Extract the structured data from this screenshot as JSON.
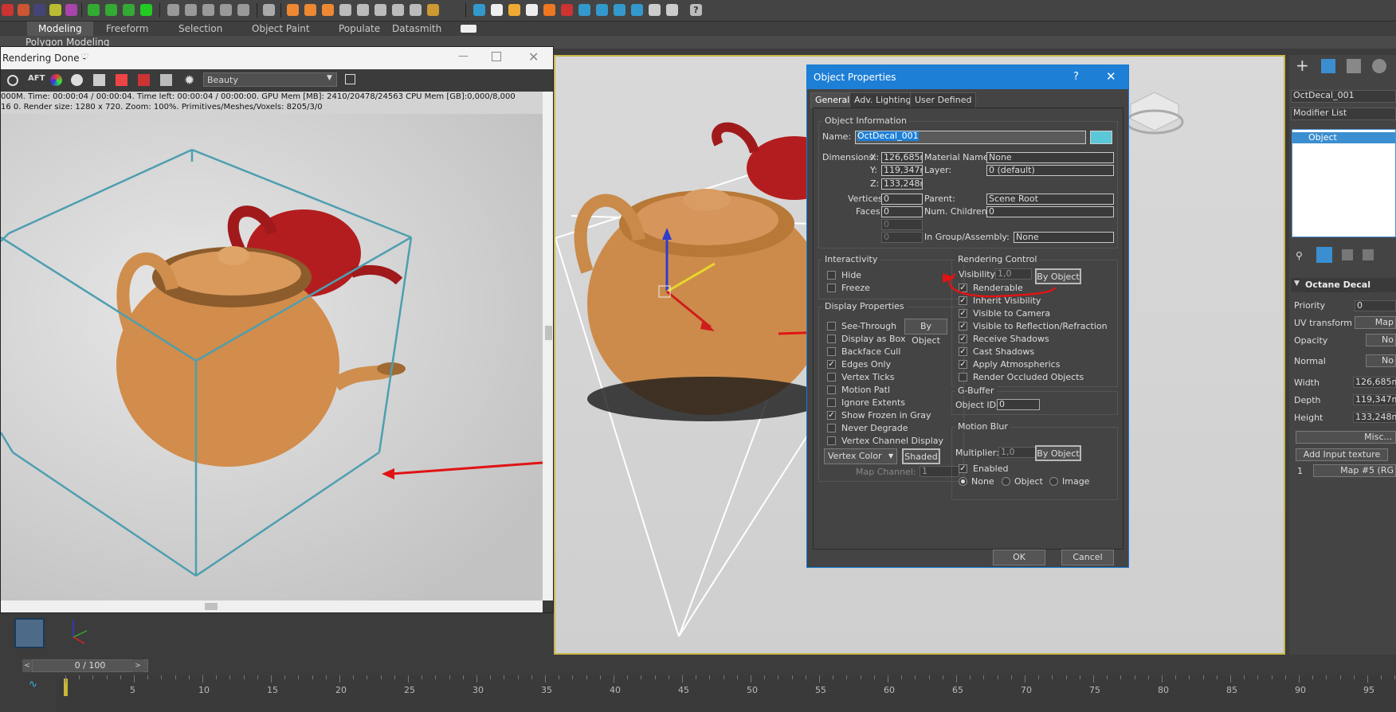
{
  "ribbon": {
    "tabs": [
      "Modeling",
      "Freeform",
      "Selection",
      "Object Paint",
      "Populate",
      "Datasmith"
    ],
    "subtitle": "Polygon Modeling"
  },
  "render_window": {
    "title": "Rendering Done -",
    "channel": "Beauty",
    "info_line1": "000M.  Time: 00:00:04 / 00:00:04.  Time left: 00:00:04 / 00:00:00.  GPU Mem [MB]: 2410/20478/24563  CPU Mem [GB]:0,000/8,000",
    "info_line2": "16 0.  Render size: 1280 x 720.  Zoom: 100%.  Primitives/Meshes/Voxels: 8205/3/0"
  },
  "dialog": {
    "title": "Object Properties",
    "tabs": [
      "General",
      "Adv. Lighting",
      "User Defined"
    ],
    "object_info": {
      "group_title": "Object Information",
      "name_label": "Name:",
      "name_value": "OctDecal_001",
      "color": "#5bc8d8",
      "dimensions_label": "Dimensions:",
      "x_label": "X:",
      "x_value": "126,685mr",
      "y_label": "Y:",
      "y_value": "119,347mr",
      "z_label": "Z:",
      "z_value": "133,248mr",
      "vertices_label": "Vertices:",
      "vertices_value": "0",
      "faces_label": "Faces:",
      "faces_value": "0",
      "extra1": "0",
      "extra2": "0",
      "material_label": "Material Name:",
      "material_value": "None",
      "layer_label": "Layer:",
      "layer_value": "0 (default)",
      "parent_label": "Parent:",
      "parent_value": "Scene Root",
      "children_label": "Num. Children:",
      "children_value": "0",
      "group_label": "In Group/Assembly:",
      "group_value": "None"
    },
    "interactivity": {
      "group_title": "Interactivity",
      "hide": "Hide",
      "freeze": "Freeze"
    },
    "display": {
      "group_title": "Display Properties",
      "by_object": "By Object",
      "see_through": "See-Through",
      "display_as_box": "Display as Box",
      "backface_cull": "Backface Cull",
      "edges_only": "Edges Only",
      "vertex_ticks": "Vertex Ticks",
      "motion_path": "Motion Patl",
      "ignore_extents": "Ignore Extents",
      "show_frozen_gray": "Show Frozen in Gray",
      "never_degrade": "Never Degrade",
      "vertex_channel_display": "Vertex Channel Display",
      "vertex_color": "Vertex Color",
      "shaded": "Shaded",
      "map_channel_label": "Map Channel:",
      "map_channel_value": "1"
    },
    "rendering": {
      "group_title": "Rendering Control",
      "visibility_label": "Visibility:",
      "visibility_value": "1,0",
      "by_object": "By Object",
      "renderable": "Renderable",
      "inherit_visibility": "Inherit Visibility",
      "visible_to_camera": "Visible to Camera",
      "visible_to_reflection": "Visible to Reflection/Refraction",
      "receive_shadows": "Receive Shadows",
      "cast_shadows": "Cast Shadows",
      "apply_atmospherics": "Apply Atmospherics",
      "render_occluded": "Render Occluded Objects"
    },
    "gbuffer": {
      "group_title": "G-Buffer",
      "object_id_label": "Object ID:",
      "object_id_value": "0"
    },
    "motion_blur": {
      "group_title": "Motion Blur",
      "multiplier_label": "Multiplier:",
      "multiplier_value": "1,0",
      "by_object": "By Object",
      "enabled": "Enabled",
      "none": "None",
      "object": "Object",
      "image": "Image"
    },
    "ok": "OK",
    "cancel": "Cancel",
    "help": "?"
  },
  "command_panel": {
    "object_name": "OctDecal_001",
    "modifier_list": "Modifier List",
    "stack_item": "Object",
    "rollout_title": "Octane Decal",
    "priority_label": "Priority",
    "priority_value": "0",
    "uv_label": "UV transform",
    "uv_value": "Map",
    "opacity_label": "Opacity",
    "opacity_value": "No",
    "normal_label": "Normal",
    "normal_value": "No",
    "width_label": "Width",
    "width_value": "126,685m",
    "depth_label": "Depth",
    "depth_value": "119,347m",
    "height_label": "Height",
    "height_value": "133,248m",
    "misc": "Misc...",
    "add_input_texture": "Add Input texture",
    "map_index": "1",
    "map_value": "Map #5 (RG"
  },
  "timeline": {
    "frame_display": "0 / 100",
    "ticks": [
      "5",
      "10",
      "15",
      "20",
      "25",
      "30",
      "35",
      "40",
      "45",
      "50",
      "55",
      "60",
      "65",
      "70",
      "75",
      "80",
      "85",
      "90",
      "95"
    ]
  }
}
